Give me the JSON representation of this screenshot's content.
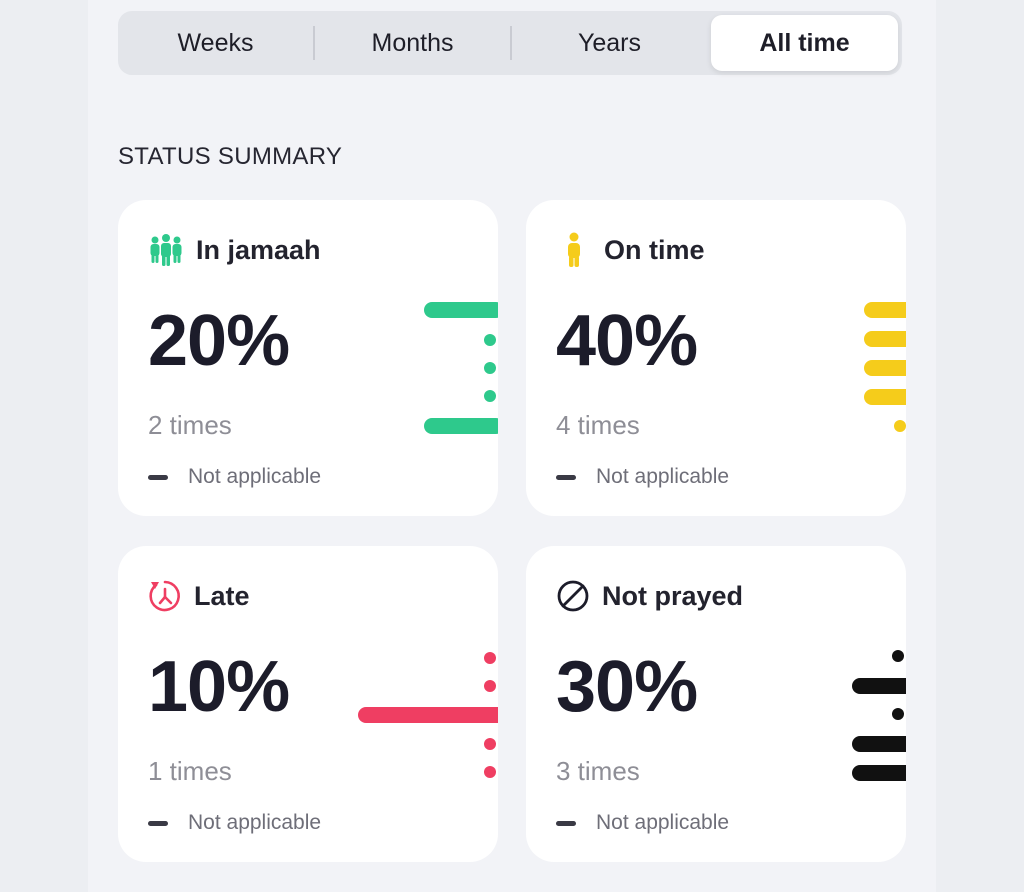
{
  "tabs": [
    {
      "label": "Weeks",
      "selected": false
    },
    {
      "label": "Months",
      "selected": false
    },
    {
      "label": "Years",
      "selected": false
    },
    {
      "label": "All time",
      "selected": true
    }
  ],
  "section": {
    "title": "STATUS SUMMARY"
  },
  "cards": [
    {
      "title": "In jamaah",
      "percent": "20%",
      "count": "2 times",
      "note": "Not applicable",
      "icon": "group-people-icon",
      "color": "#2ec98c"
    },
    {
      "title": "On time",
      "percent": "40%",
      "count": "4 times",
      "note": "Not applicable",
      "icon": "person-icon",
      "color": "#f5cc1b"
    },
    {
      "title": "Late",
      "percent": "10%",
      "count": "1 times",
      "note": "Not applicable",
      "icon": "late-clock-icon",
      "color": "#ef3e62"
    },
    {
      "title": "Not prayed",
      "percent": "30%",
      "count": "3 times",
      "note": "Not applicable",
      "icon": "prohibited-icon",
      "color": "#111111"
    }
  ]
}
